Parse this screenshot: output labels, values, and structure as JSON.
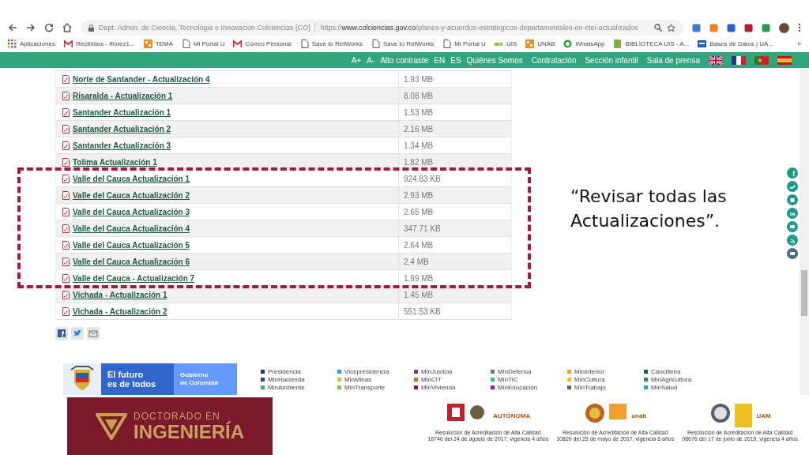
{
  "browser": {
    "site": "Dept. Admin. de Ciencia, Tecnologia e Innovacion Colciencias [CO]",
    "url": "https://**www.colciencias.gov.co**/planes-y-acuerdos-estrategicos-departamentales-en-ctei-actualizados",
    "bookmarks": [
      {
        "label": "Aplicaciones",
        "kind": "apps"
      },
      {
        "label": "Recibidos - iflorez1...",
        "kind": "mail"
      },
      {
        "label": "TEMA",
        "kind": "tile"
      },
      {
        "label": "Mi Portal U",
        "kind": "page"
      },
      {
        "label": "Correo Personal",
        "kind": "mail"
      },
      {
        "label": "Save to RefWorks",
        "kind": "page"
      },
      {
        "label": "Save to RefWorks",
        "kind": "page"
      },
      {
        "label": "Mi Portal U",
        "kind": "page"
      },
      {
        "label": "UIS",
        "kind": "bars"
      },
      {
        "label": "UNAB",
        "kind": "tile"
      },
      {
        "label": "WhatsApp",
        "kind": "chat"
      },
      {
        "label": "BIBLIOTECA UIS - A...",
        "kind": "book"
      },
      {
        "label": "Bases de Datos | UA...",
        "kind": "db"
      }
    ],
    "more": "»"
  },
  "nav": [
    "A+",
    "A-",
    "Alto contraste",
    "EN",
    "ES",
    "Quiénes Somos",
    "Contratación",
    "Sección infantil",
    "Sala de prensa"
  ],
  "table": {
    "rows": [
      {
        "name": "Norte de Santander - Actualización 4",
        "size": "1.93 MB"
      },
      {
        "name": "Risaralda - Actualización 1",
        "size": "8.08 MB"
      },
      {
        "name": "Santander Actualización 1",
        "size": "1.53 MB"
      },
      {
        "name": "Santander Actualización 2",
        "size": "2.16 MB"
      },
      {
        "name": "Santander Actualización 3",
        "size": "1.34 MB"
      },
      {
        "name": "Tolima Actualización 1",
        "size": "1.82 MB"
      },
      {
        "name": "Valle del Cauca Actualización 1",
        "size": "924.83 KB"
      },
      {
        "name": "Valle del Cauca Actualización 2",
        "size": "2.93 MB"
      },
      {
        "name": "Valle del Cauca Actualización 3",
        "size": "2.65 MB"
      },
      {
        "name": "Valle del Cauca Actualización 4",
        "size": "347.71 KB"
      },
      {
        "name": "Valle del Cauca Actualización 5",
        "size": "2.64 MB"
      },
      {
        "name": "Valle del Cauca Actualización 6",
        "size": "2.4 MB"
      },
      {
        "name": "Valle del Cauca - Actualización 7",
        "size": "1.99 MB"
      },
      {
        "name": "Vichada - Actualización 1",
        "size": "1.45 MB"
      },
      {
        "name": "Vichada - Actualización 2",
        "size": "551.53 KB"
      }
    ]
  },
  "note": [
    "“Revisar todas las",
    "Actualizaciones”."
  ],
  "footer": {
    "slogan": [
      "El futuro",
      "es de todos"
    ],
    "government": [
      "Gobierno",
      "de Colombia"
    ],
    "links": [
      {
        "label": "Presidencia",
        "color": "#1f3a68"
      },
      {
        "label": "Vicepresidencia",
        "color": "#2b9fd9"
      },
      {
        "label": "MinJusticia",
        "color": "#6a3d9a"
      },
      {
        "label": "MinDefensa",
        "color": "#6b7b7b"
      },
      {
        "label": "MinInterior",
        "color": "#f0a030"
      },
      {
        "label": "Cancilleria",
        "color": "#1a5a4a"
      },
      {
        "label": "MinHacienda",
        "color": "#3040a0"
      },
      {
        "label": "MinMinas",
        "color": "#b8d040"
      },
      {
        "label": "MinCIT",
        "color": "#f06020"
      },
      {
        "label": "MinTIC",
        "color": "#20b8c8"
      },
      {
        "label": "MinCultura",
        "color": "#f0c020"
      },
      {
        "label": "MinAgricultura",
        "color": "#209070"
      },
      {
        "label": "MinAmbiente",
        "color": "#50b050"
      },
      {
        "label": "MinTransporte",
        "color": "#80c050"
      },
      {
        "label": "MinVivienda",
        "color": "#a01040"
      },
      {
        "label": "MinEducación",
        "color": "#a020a0"
      },
      {
        "label": "MinTrabajo",
        "color": "#806040"
      },
      {
        "label": "MinSalud",
        "color": "#30a0d0"
      }
    ]
  },
  "slide": {
    "program": [
      "DOCTORADO EN",
      "INGENIERÍA"
    ],
    "logos": [
      {
        "name": "AUTÓNOMA",
        "caption": [
          "Resolución de Acreditación de Alta Calidad",
          "16740 del 24 de agosto de 2017, vigencia 4 años"
        ]
      },
      {
        "name": "unab",
        "caption": [
          "Resolución de Acreditación de Alta Calidad",
          "10820 del 25 de mayo de 2017, vigencia 6 años"
        ]
      },
      {
        "name": "UAM",
        "caption": [
          "Resolución de Acreditación de Alta Calidad",
          "08676 del 17 de junio de 2015, vigencia 4 años"
        ]
      }
    ]
  }
}
